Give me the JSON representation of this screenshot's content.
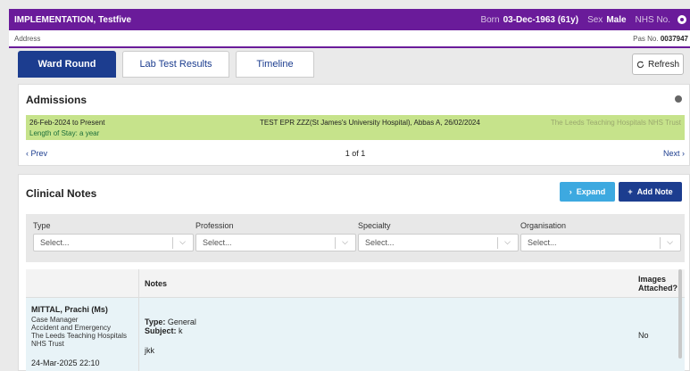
{
  "banner": {
    "patient_name": "IMPLEMENTATION, Testfive",
    "born_label": "Born",
    "born_value": "03-Dec-1963 (61y)",
    "sex_label": "Sex",
    "sex_value": "Male",
    "nhs_label": "NHS No."
  },
  "address_bar": {
    "address_label": "Address",
    "pas_label": "Pas No.",
    "pas_value": "0037947"
  },
  "tabs": [
    {
      "label": "Ward Round",
      "active": true
    },
    {
      "label": "Lab Test Results",
      "active": false
    },
    {
      "label": "Timeline",
      "active": false
    }
  ],
  "refresh_label": "Refresh",
  "admissions": {
    "title": "Admissions",
    "row": {
      "dates": "26-Feb-2024 to Present",
      "length_of_stay": "Length of Stay: a year",
      "location": "TEST EPR ZZZ(St James's University Hospital), Abbas A, 26/02/2024",
      "trust": "The Leeds Teaching Hospitals NHS Trust"
    },
    "pager": {
      "prev": "Prev",
      "page": "1 of 1",
      "next": "Next"
    }
  },
  "clinical_notes": {
    "title": "Clinical Notes",
    "expand_label": "Expand",
    "add_note_label": "Add Note",
    "filters": [
      {
        "label": "Type",
        "placeholder": "Select..."
      },
      {
        "label": "Profession",
        "placeholder": "Select..."
      },
      {
        "label": "Specialty",
        "placeholder": "Select..."
      },
      {
        "label": "Organisation",
        "placeholder": "Select..."
      }
    ],
    "columns": {
      "notes": "Notes",
      "images": "Images Attached?"
    },
    "rows": [
      {
        "author": "MITTAL, Prachi (Ms)",
        "role": "Case Manager",
        "department": "Accident and Emergency",
        "trust": "The Leeds Teaching Hospitals NHS Trust",
        "datetime": "24-Mar-2025 22:10",
        "type_label": "Type:",
        "type_value": "General",
        "subject_label": "Subject:",
        "subject_value": "k",
        "body": "jkk",
        "images": "No"
      }
    ]
  },
  "colors": {
    "banner": "#6a1b9a",
    "primary": "#1c3d8f",
    "admission_row": "#c6e38b",
    "expand": "#3da9e0"
  }
}
